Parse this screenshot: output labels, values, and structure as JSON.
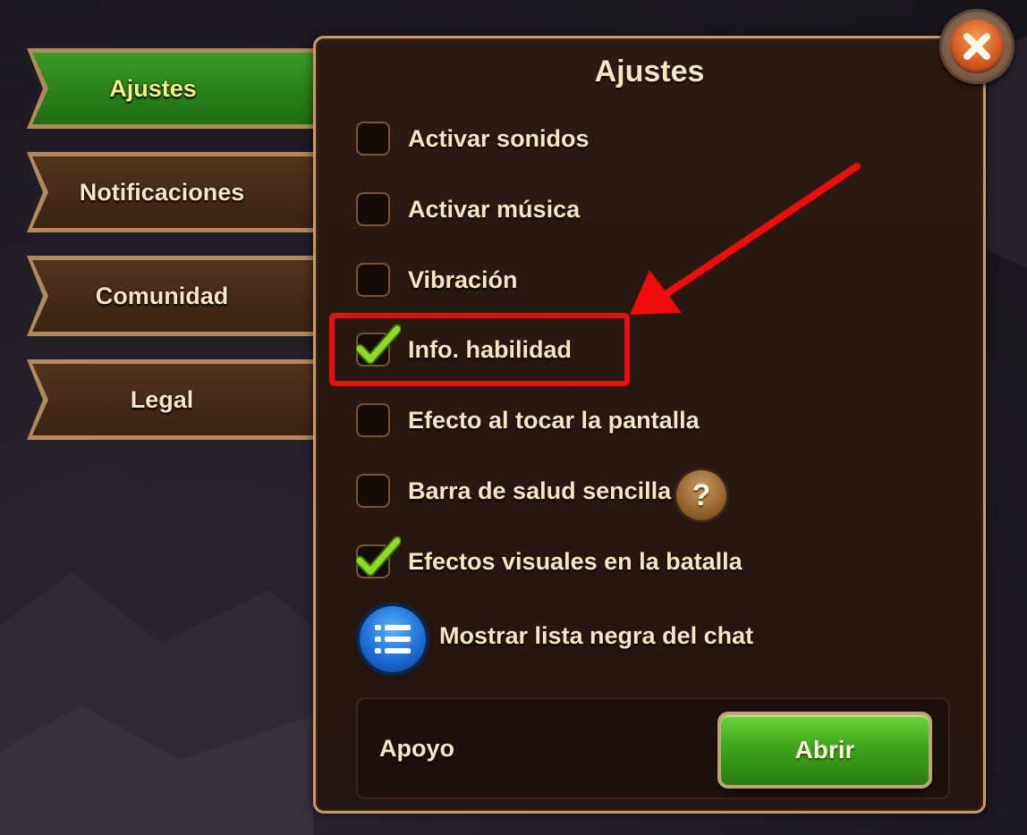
{
  "tabs": [
    {
      "label": "Ajustes",
      "active": true
    },
    {
      "label": "Notificaciones",
      "active": false
    },
    {
      "label": "Comunidad",
      "active": false
    },
    {
      "label": "Legal",
      "active": false
    }
  ],
  "panel": {
    "title": "Ajustes",
    "close_icon": "close-x-icon"
  },
  "options": [
    {
      "label": "Activar sonidos",
      "checked": false
    },
    {
      "label": "Activar música",
      "checked": false
    },
    {
      "label": "Vibración",
      "checked": false
    },
    {
      "label": "Info. habilidad",
      "checked": true
    },
    {
      "label": "Efecto al tocar la pantalla",
      "checked": false
    },
    {
      "label": "Barra de salud sencilla",
      "checked": false
    },
    {
      "label": "Efectos visuales en la batalla",
      "checked": true
    }
  ],
  "help_button": {
    "glyph": "?"
  },
  "blacklist": {
    "label": "Mostrar lista negra del chat",
    "icon": "list-icon"
  },
  "support": {
    "label": "Apoyo",
    "button_label": "Abrir"
  },
  "annotation": {
    "highlight_target": "Info. habilidad",
    "color": "#ef0c0c"
  },
  "colors": {
    "active_tab": "#2f8a1c",
    "inactive_tab": "#4a2c19",
    "panel_border": "#c99a6a",
    "text": "#f6e6c2",
    "check": "#7fd020"
  }
}
